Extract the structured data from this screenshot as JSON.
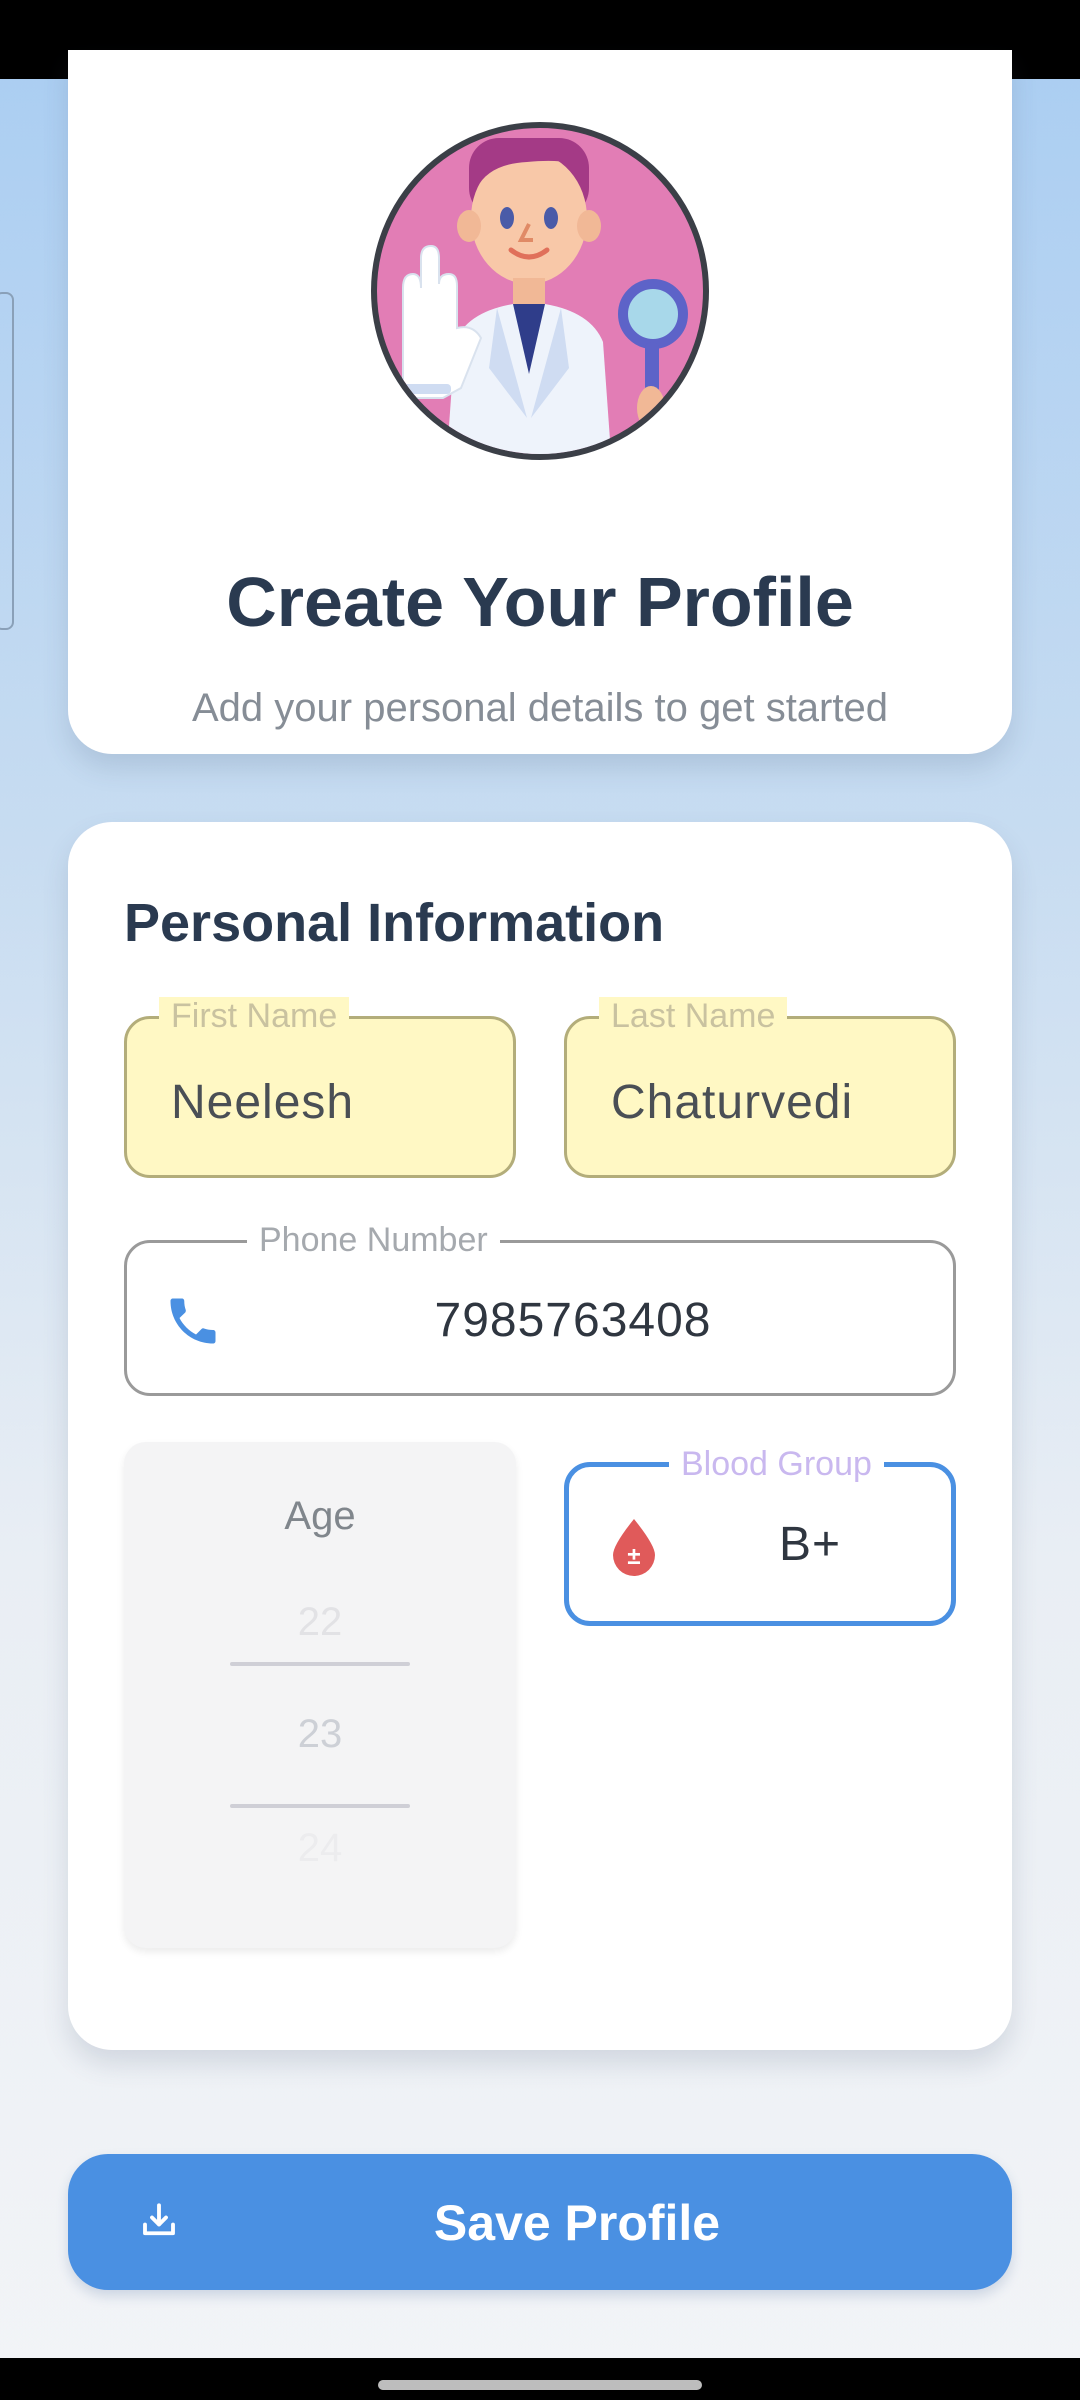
{
  "header": {
    "title": "Create Your Profile",
    "subtitle": "Add your personal details to get started"
  },
  "form": {
    "section_title": "Personal Information",
    "first_name": {
      "label": "First Name",
      "value": "Neelesh"
    },
    "last_name": {
      "label": "Last Name",
      "value": "Chaturvedi"
    },
    "phone": {
      "label": "Phone Number",
      "value": "7985763408"
    },
    "age": {
      "label": "Age",
      "options": [
        "22",
        "23",
        "24"
      ],
      "selected": "23"
    },
    "blood_group": {
      "label": "Blood Group",
      "value": "B+"
    }
  },
  "actions": {
    "save_label": "Save Profile"
  },
  "icons": {
    "avatar": "doctor-avatar-icon",
    "phone": "phone-icon",
    "blood": "blood-drop-icon",
    "save": "download-icon"
  },
  "colors": {
    "accent": "#4a90e2",
    "title": "#2a3a50",
    "autofill": "#fff8c4",
    "blood_icon": "#e05a5a",
    "blood_label": "#c9b8ef"
  }
}
